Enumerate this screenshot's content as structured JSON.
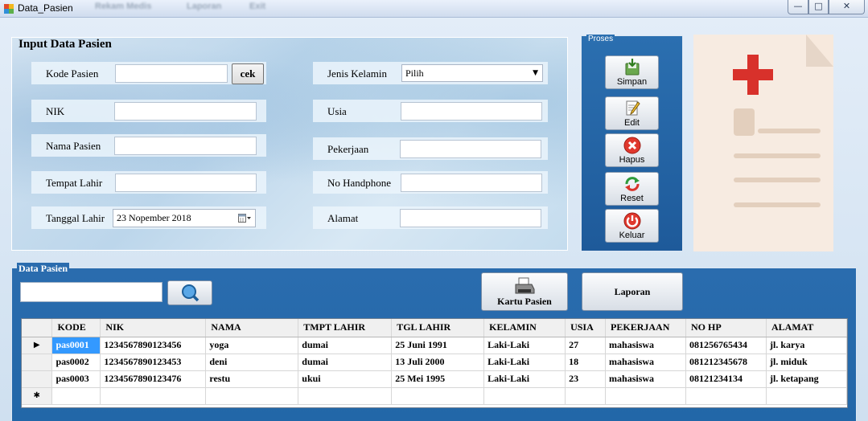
{
  "window": {
    "title": "Data_Pasien",
    "min_symbol": "—",
    "max_symbol": "□",
    "close_symbol": "✕",
    "blurred_menu": [
      "Rekam Medis",
      "Laporan",
      "Exit"
    ]
  },
  "input_panel": {
    "title": "Input Data Pasien",
    "left_fields": {
      "kode_label": "Kode Pasien",
      "kode_value": "",
      "cek_label": "cek",
      "nik_label": "NIK",
      "nik_value": "",
      "nama_label": "Nama Pasien",
      "nama_value": "",
      "tempat_label": "Tempat Lahir",
      "tempat_value": "",
      "tanggal_label": "Tanggal Lahir",
      "tanggal_value": "23 Nopember 2018"
    },
    "right_fields": {
      "jk_label": "Jenis Kelamin",
      "jk_value": "Pilih",
      "usia_label": "Usia",
      "usia_value": "",
      "pekerjaan_label": "Pekerjaan",
      "pekerjaan_value": "",
      "hp_label": "No Handphone",
      "hp_value": "",
      "alamat_label": "Alamat",
      "alamat_value": ""
    }
  },
  "proses": {
    "title": "Proses",
    "buttons": {
      "simpan": "Simpan",
      "edit": "Edit",
      "hapus": "Hapus",
      "reset": "Reset",
      "keluar": "Keluar"
    }
  },
  "data_panel": {
    "title": "Data Pasien",
    "search_value": "",
    "kartu_label": "Kartu Pasien",
    "laporan_label": "Laporan",
    "columns": [
      "KODE",
      "NIK",
      "NAMA",
      "TMPT LAHIR",
      "TGL LAHIR",
      "KELAMIN",
      "USIA",
      "PEKERJAAN",
      "NO HP",
      "ALAMAT"
    ],
    "rows": [
      [
        "pas0001",
        "1234567890123456",
        "yoga",
        "dumai",
        "25 Juni 1991",
        "Laki-Laki",
        "27",
        "mahasiswa",
        "081256765434",
        "jl. karya"
      ],
      [
        "pas0002",
        "1234567890123453",
        "deni",
        "dumai",
        "13 Juli 2000",
        "Laki-Laki",
        "18",
        "mahasiswa",
        "081212345678",
        "jl. miduk"
      ],
      [
        "pas0003",
        "1234567890123476",
        "restu",
        "ukui",
        "25 Mei 1995",
        "Laki-Laki",
        "23",
        "mahasiswa",
        "08121234134",
        "jl. ketapang"
      ]
    ],
    "current_row_marker": "▶",
    "new_row_marker": "✱"
  },
  "colors": {
    "proses_bg": "#2b6fb0",
    "data_bg": "#2a6cae",
    "selected_cell": "#3399ff",
    "red_cross": "#d8312b"
  }
}
